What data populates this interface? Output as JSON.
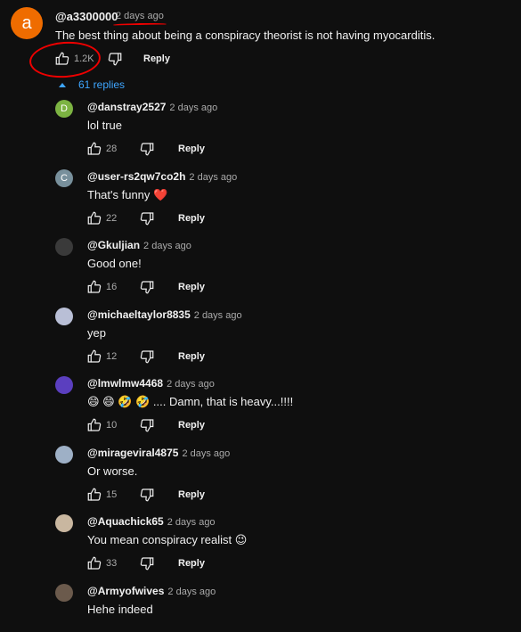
{
  "comment": {
    "avatar_letter": "a",
    "author": "@a3300000",
    "time": "2 days ago",
    "text": "The best thing about being a conspiracy theorist is not having myocarditis.",
    "likes": "1.2K",
    "reply_label": "Reply",
    "replies_toggle": "61 replies"
  },
  "replies": [
    {
      "author": "@danstray2527",
      "time": "2 days ago",
      "text": "lol true",
      "likes": "28",
      "avatar_letter": "D",
      "avatar_color": "#7cb342"
    },
    {
      "author": "@user-rs2qw7co2h",
      "time": "2 days ago",
      "text": "That's funny ❤️",
      "likes": "22",
      "avatar_letter": "C",
      "avatar_color": "#78909c"
    },
    {
      "author": "@Gkuljian",
      "time": "2 days ago",
      "text": "Good one!",
      "likes": "16",
      "avatar_letter": "",
      "avatar_color": "#3a3a3a"
    },
    {
      "author": "@michaeltaylor8835",
      "time": "2 days ago",
      "text": "yep",
      "likes": "12",
      "avatar_letter": "",
      "avatar_color": "#b9bfd6"
    },
    {
      "author": "@lmwlmw4468",
      "time": "2 days ago",
      "text": "😄 😄 🤣 🤣 .... Damn, that is heavy...!!!!",
      "likes": "10",
      "avatar_letter": "",
      "avatar_color": "#5b3fbf"
    },
    {
      "author": "@mirageviral4875",
      "time": "2 days ago",
      "text": "Or worse.",
      "likes": "15",
      "avatar_letter": "",
      "avatar_color": "#9eb0c6"
    },
    {
      "author": "@Aquachick65",
      "time": "2 days ago",
      "text": "You mean conspiracy realist 😉",
      "likes": "33",
      "avatar_letter": "",
      "avatar_color": "#c9b7a0"
    },
    {
      "author": "@Armyofwives",
      "time": "2 days ago",
      "text": "Hehe indeed",
      "likes": "",
      "avatar_letter": "",
      "avatar_color": "#6b5a4c"
    }
  ],
  "reply_label": "Reply",
  "icons": {
    "like": "thumbs-up-icon",
    "dislike": "thumbs-down-icon",
    "caret": "caret-up-icon"
  },
  "colors": {
    "background": "#0f0f0f",
    "link": "#3ea6ff",
    "annotation": "#ee0000",
    "main_avatar": "#ef6c00"
  }
}
